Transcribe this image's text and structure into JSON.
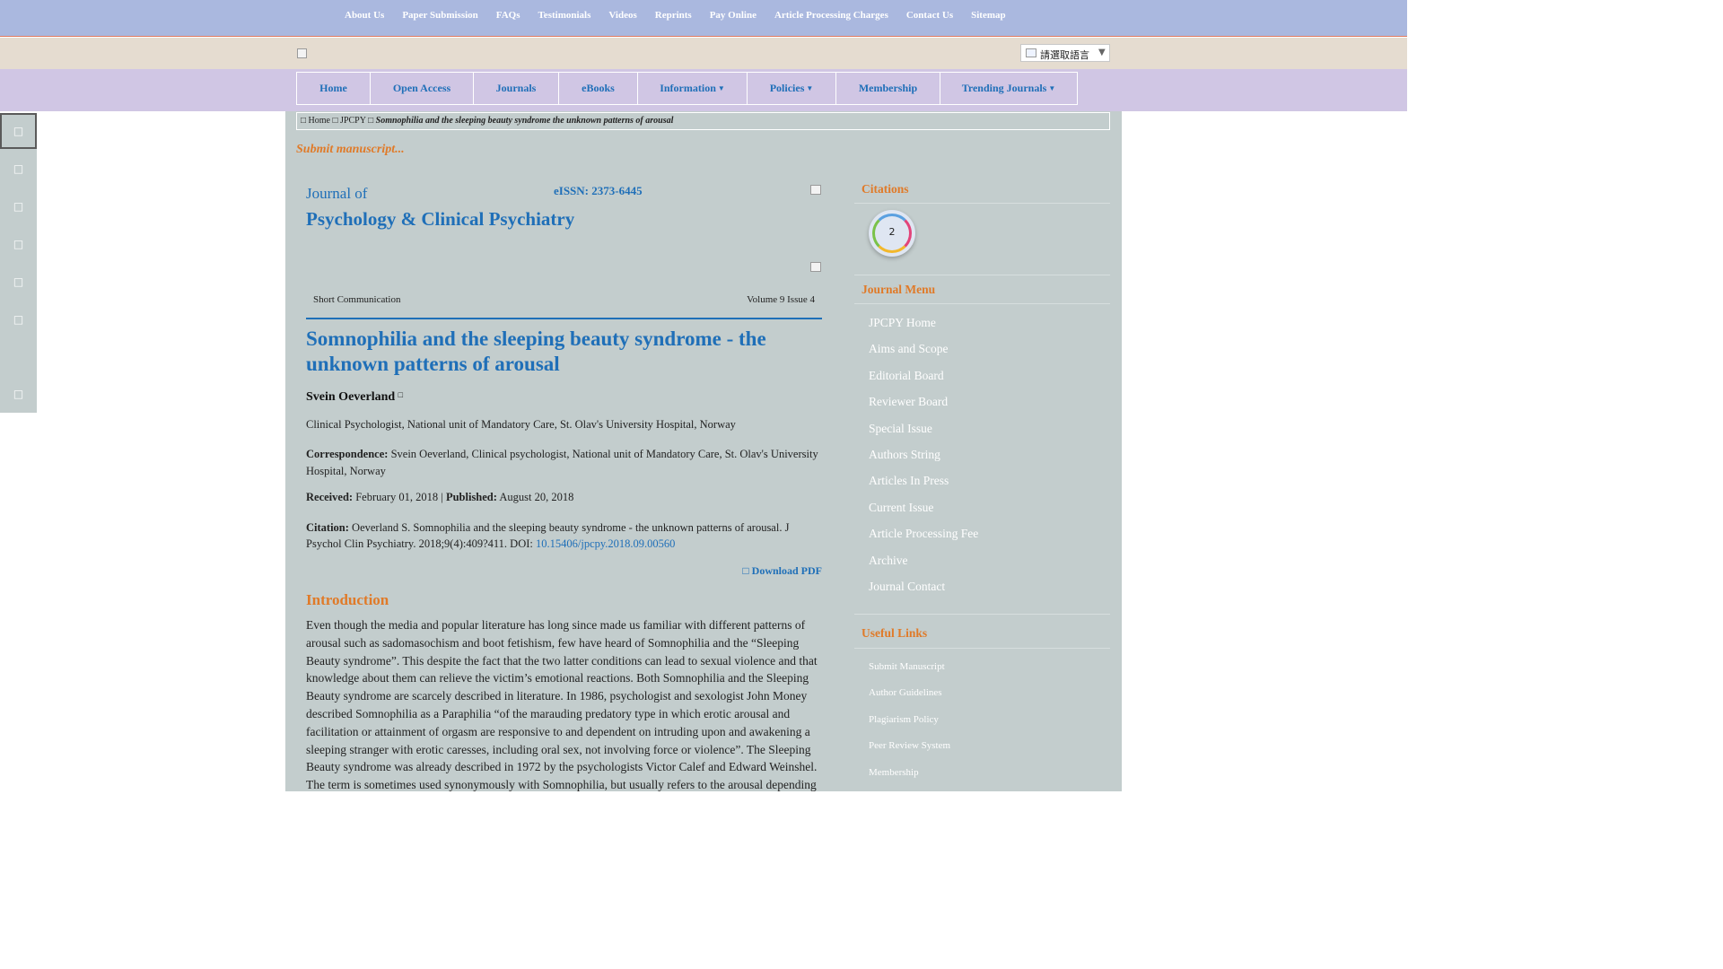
{
  "top_links": [
    "About Us",
    "Paper Submission",
    "FAQs",
    "Testimonials",
    "Videos",
    "Reprints",
    "Pay Online",
    "Article Processing Charges",
    "Contact Us",
    "Sitemap"
  ],
  "language_select": {
    "label": "請選取語言",
    "arrow": "▼"
  },
  "nav": [
    {
      "label": "Home",
      "dropdown": false
    },
    {
      "label": "Open Access",
      "dropdown": false
    },
    {
      "label": "Journals",
      "dropdown": false
    },
    {
      "label": "eBooks",
      "dropdown": false
    },
    {
      "label": "Information",
      "dropdown": true
    },
    {
      "label": "Policies",
      "dropdown": true
    },
    {
      "label": "Membership",
      "dropdown": false
    },
    {
      "label": "Trending Journals",
      "dropdown": true
    }
  ],
  "breadcrumb": {
    "home": " Home",
    "journal": "JPCPY",
    "current": "Somnophilia and the sleeping beauty syndrome the unknown patterns of arousal"
  },
  "submit_link": "Submit manuscript...",
  "journal": {
    "prefix": "Journal of",
    "title": "Psychology & Clinical Psychiatry",
    "eissn": "eISSN: 2373-6445"
  },
  "article": {
    "type": "Short Communication",
    "volume": "Volume 9 Issue 4",
    "title": "Somnophilia and the sleeping beauty syndrome - the unknown patterns of arousal",
    "author": "Svein Oeverland",
    "affiliation": "Clinical Psychologist, National unit of Mandatory Care, St. Olav's University Hospital, Norway",
    "correspondence_label": "Correspondence:",
    "correspondence": "Svein Oeverland, Clinical psychologist, National unit of Mandatory Care, St. Olav's University Hospital, Norway",
    "received_label": "Received:",
    "received": "February 01, 2018",
    "separator": "|",
    "published_label": "Published:",
    "published": "August 20, 2018",
    "citation_label": "Citation:",
    "citation": "Oeverland S. Somnophilia and the sleeping beauty syndrome - the unknown patterns of arousal. J Psychol Clin Psychiatry. 2018;9(4):409?411. DOI:",
    "doi": "10.15406/jpcpy.2018.09.00560",
    "download": "Download PDF",
    "intro_heading": "Introduction",
    "intro_text": "Even though the media and popular literature has long since made us familiar with different patterns of arousal such as sadomasochism and boot fetishism, few have heard of Somnophilia and the “Sleeping Beauty syndrome”. This despite the fact that the two latter conditions can lead to sexual violence and that knowledge about them can relieve the victim’s emotional reactions. Both Somnophilia and the Sleeping Beauty syndrome are scarcely described in literature. In 1986, psychologist and sexologist John Money described Somnophilia as a Paraphilia “of the marauding predatory type in which erotic arousal and facilitation or attainment of orgasm are responsive to and dependent on intruding upon and awakening a sleeping stranger with erotic caresses, including oral sex, not involving force or violence”. The Sleeping Beauty syndrome was already described in 1972 by the psychologists Victor Calef and Edward Weinshel. The term is sometimes used synonymously with Somnophilia, but usually refers to the arousal depending"
  },
  "sidebar": {
    "citations_heading": "Citations",
    "citations_count": "2",
    "journal_menu_heading": "Journal Menu",
    "journal_menu": [
      "JPCPY Home",
      "Aims and Scope",
      "Editorial Board",
      "Reviewer Board",
      "Special Issue",
      "Authors String",
      "Articles In Press",
      "Current Issue",
      "Article Processing Fee",
      "Archive",
      "Journal Contact"
    ],
    "useful_links_heading": "Useful Links",
    "useful_links": [
      "Submit Manuscript",
      "Author Guidelines",
      "Plagiarism Policy",
      "Peer Review System",
      "Membership"
    ]
  },
  "colors": {
    "link_blue": "#1f6fb8",
    "heading_orange": "#e07a28",
    "content_bg": "#c3cdcd",
    "nav_bg": "#d0c6e4",
    "topbar_bg": "#aab8df"
  },
  "icons": [
    "image-placeholder-icon",
    "google-translate-icon",
    "envelope-icon",
    "file-pdf-icon",
    "social-share-icons"
  ]
}
